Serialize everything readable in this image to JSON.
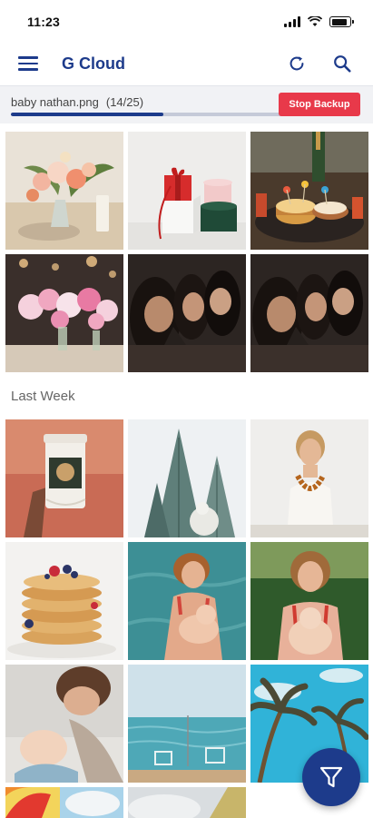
{
  "status_bar": {
    "time": "11:23",
    "icons": [
      "signal-icon",
      "wifi-icon",
      "battery-icon"
    ]
  },
  "app_bar": {
    "title": "G Cloud",
    "menu_icon": "hamburger-menu-icon",
    "refresh_icon": "refresh-icon",
    "search_icon": "search-icon"
  },
  "backup": {
    "file_name": "baby nathan.png",
    "progress_text": "(14/25)",
    "progress_fraction": 0.56,
    "stop_label": "Stop Backup",
    "stop_color": "#e8394a"
  },
  "sections": [
    {
      "title": "",
      "photos": [
        "flower-arrangement-photo",
        "gift-boxes-photo",
        "party-cake-photo",
        "pink-flowers-table-photo",
        "friends-laughing-photo",
        "friends-laughing-photo-2"
      ]
    },
    {
      "title": "Last Week",
      "photos": [
        "coffee-cup-photo",
        "cathedral-spire-photo",
        "woman-necklace-photo",
        "pancake-stack-photo",
        "mother-baby-pool-photo",
        "mother-baby-garden-photo",
        "sleeping-baby-photo",
        "beach-chairs-photo",
        "palm-trees-photo",
        "sunset-sky-photo",
        "cloudy-sky-photo"
      ]
    }
  ],
  "fab": {
    "icon": "filter-icon"
  },
  "colors": {
    "accent": "#1d3b8b",
    "panel": "#f1f2f5",
    "danger": "#e8394a"
  }
}
